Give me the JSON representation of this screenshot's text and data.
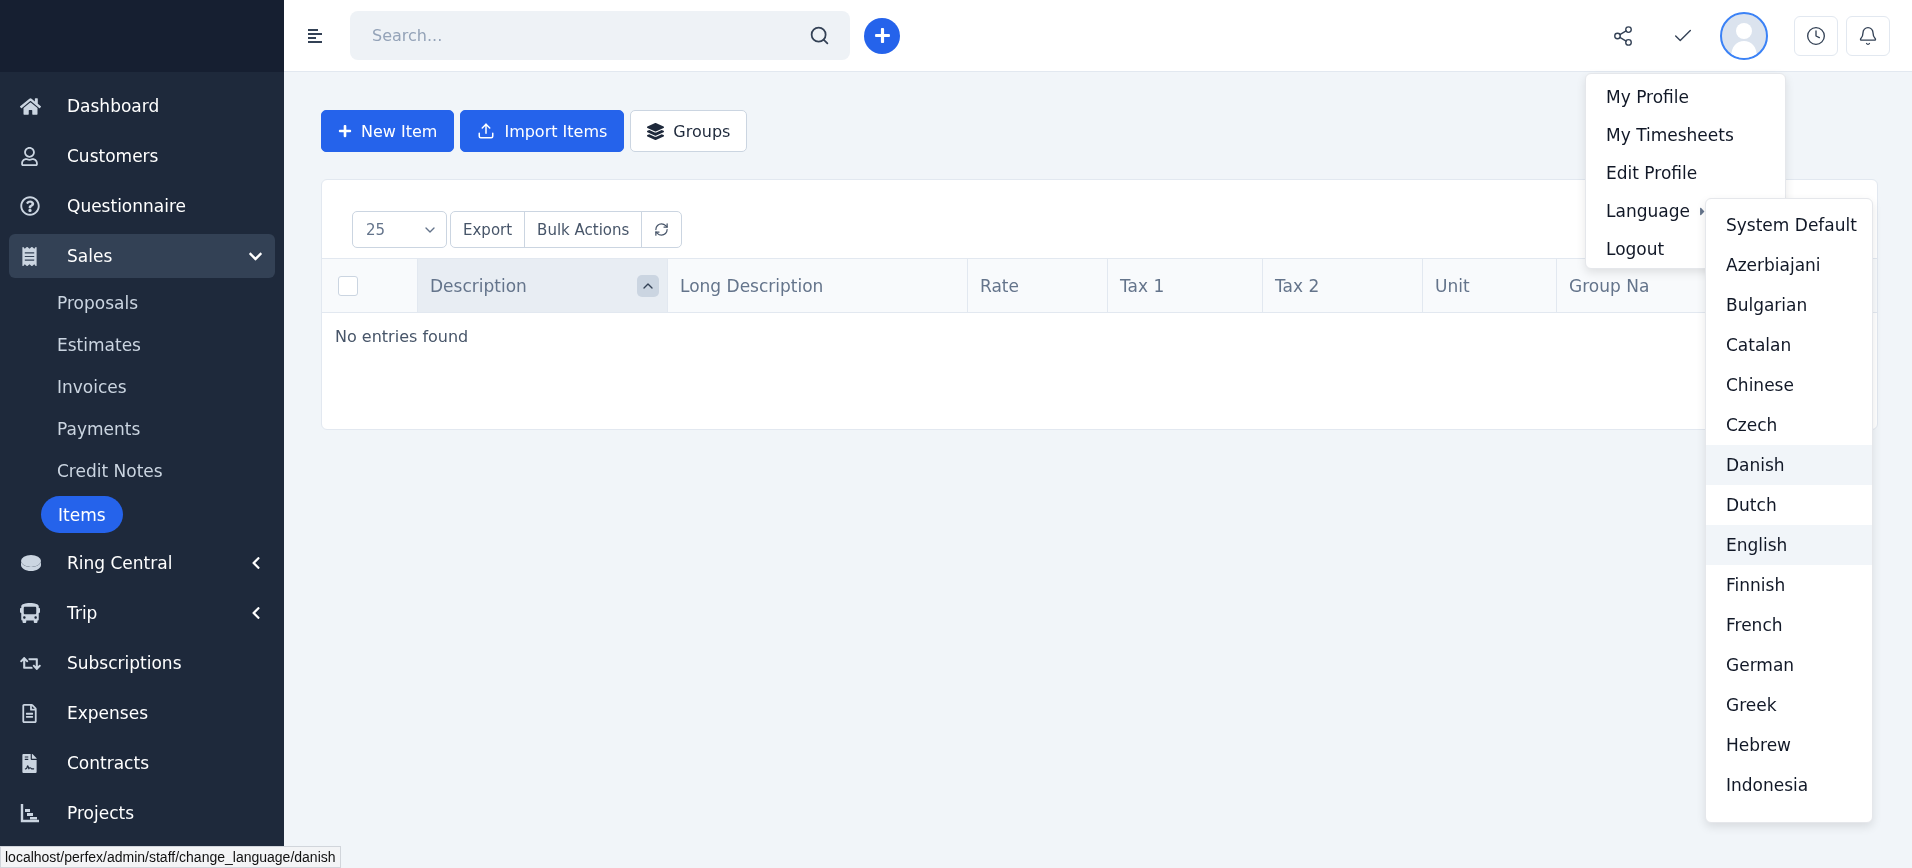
{
  "topbar": {
    "search": {
      "placeholder": "Search..."
    }
  },
  "sidebar": {
    "items": [
      {
        "label": "Dashboard",
        "selected": false
      },
      {
        "label": "Customers",
        "selected": false
      },
      {
        "label": "Questionnaire",
        "selected": false
      },
      {
        "label": "Sales",
        "selected": true,
        "expanded": true,
        "children": [
          {
            "label": "Proposals",
            "selected": false
          },
          {
            "label": "Estimates",
            "selected": false
          },
          {
            "label": "Invoices",
            "selected": false
          },
          {
            "label": "Payments",
            "selected": false
          },
          {
            "label": "Credit Notes",
            "selected": false
          },
          {
            "label": "Items",
            "selected": true
          }
        ]
      },
      {
        "label": "Ring Central",
        "selected": false,
        "expanded": false
      },
      {
        "label": "Trip",
        "selected": false,
        "expanded": false
      },
      {
        "label": "Subscriptions",
        "selected": false
      },
      {
        "label": "Expenses",
        "selected": false
      },
      {
        "label": "Contracts",
        "selected": false
      },
      {
        "label": "Projects",
        "selected": false
      }
    ]
  },
  "actions": [
    {
      "label": "New Item",
      "kind": "primary"
    },
    {
      "label": "Import Items",
      "kind": "primary"
    },
    {
      "label": "Groups",
      "kind": "secondary"
    }
  ],
  "table": {
    "page_size": "25",
    "select_all_checked": false,
    "tools": [
      "Export",
      "Bulk Actions"
    ],
    "columns": [
      {
        "label": "Description",
        "sorted": true
      },
      {
        "label": "Long Description",
        "sorted": false
      },
      {
        "label": "Rate",
        "sorted": false
      },
      {
        "label": "Tax 1",
        "sorted": false
      },
      {
        "label": "Tax 2",
        "sorted": false
      },
      {
        "label": "Unit",
        "sorted": false
      },
      {
        "label": "Group Na",
        "sorted": false
      }
    ],
    "empty_message": "No entries found"
  },
  "profile_menu": {
    "items": [
      {
        "label": "My Profile",
        "submenu": false
      },
      {
        "label": "My Timesheets",
        "submenu": false
      },
      {
        "label": "Edit Profile",
        "submenu": false
      },
      {
        "label": "Language",
        "submenu": true
      },
      {
        "label": "Logout",
        "submenu": false
      }
    ]
  },
  "language_menu": {
    "items": [
      {
        "label": "System Default",
        "highlighted": false
      },
      {
        "label": "Azerbiajani",
        "highlighted": false
      },
      {
        "label": "Bulgarian",
        "highlighted": false
      },
      {
        "label": "Catalan",
        "highlighted": false
      },
      {
        "label": "Chinese",
        "highlighted": false
      },
      {
        "label": "Czech",
        "highlighted": false
      },
      {
        "label": "Danish",
        "highlighted": true
      },
      {
        "label": "Dutch",
        "highlighted": false
      },
      {
        "label": "English",
        "highlighted": true
      },
      {
        "label": "Finnish",
        "highlighted": false
      },
      {
        "label": "French",
        "highlighted": false
      },
      {
        "label": "German",
        "highlighted": false
      },
      {
        "label": "Greek",
        "highlighted": false
      },
      {
        "label": "Hebrew",
        "highlighted": false
      },
      {
        "label": "Indonesia",
        "highlighted": false
      }
    ]
  },
  "status_url": "localhost/perfex/admin/staff/change_language/danish"
}
